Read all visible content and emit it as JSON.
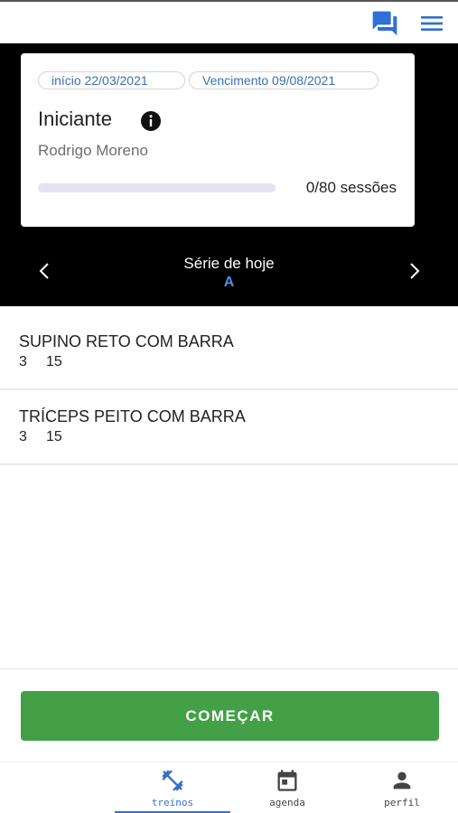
{
  "header": {
    "chat_icon": "chat-bubbles-icon",
    "menu_icon": "hamburger-menu-icon",
    "accent_color": "#2f6fd8"
  },
  "plan": {
    "start_chip": "início 22/03/2021",
    "due_chip": "Vencimento 09/08/2021",
    "title": "Iniciante",
    "info_icon": "info-icon",
    "trainer": "Rodrigo Moreno",
    "progress_value": 0,
    "progress_total": 80,
    "progress_label": "0/80 sessões"
  },
  "series": {
    "title": "Série de hoje",
    "letter": "A",
    "prev_icon": "chevron-left-icon",
    "next_icon": "chevron-right-icon"
  },
  "exercises": [
    {
      "name": "SUPINO RETO COM BARRA",
      "sets": "3",
      "reps": "15"
    },
    {
      "name": "TRÍCEPS PEITO COM BARRA",
      "sets": "3",
      "reps": "15"
    }
  ],
  "actions": {
    "start_label": "COMEÇAR",
    "start_color": "#43a047"
  },
  "nav": {
    "items": [
      {
        "label": "treinos",
        "icon": "dumbbell-icon",
        "active": true
      },
      {
        "label": "agenda",
        "icon": "calendar-icon",
        "active": false
      },
      {
        "label": "perfil",
        "icon": "person-icon",
        "active": false
      }
    ]
  }
}
